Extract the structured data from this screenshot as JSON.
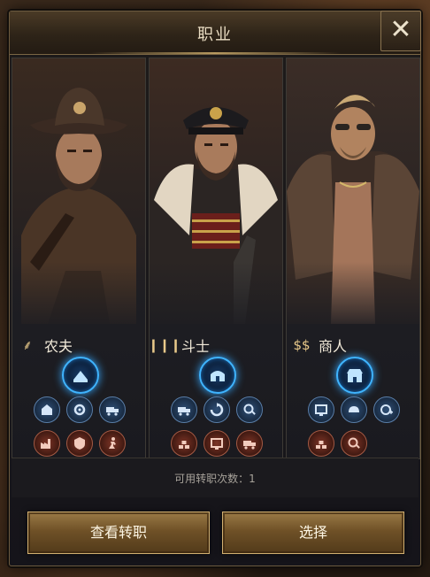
{
  "title": "职业",
  "close_label": "✕",
  "classes": [
    {
      "name": "农夫",
      "icon": "wheat-icon",
      "icon_glyph": "⸙"
    },
    {
      "name": "斗士",
      "icon": "bullets-icon",
      "icon_glyph": "❙❙❙"
    },
    {
      "name": "商人",
      "icon": "dollar-icon",
      "icon_glyph": "$$"
    }
  ],
  "remaining_label": "可用转职次数：1",
  "buttons": {
    "view": "查看转职",
    "select": "选择"
  },
  "colors": {
    "accent_gold": "#d2b071",
    "skill_blue_glow": "#3fb4ff",
    "skill_red": "#7c3426"
  }
}
